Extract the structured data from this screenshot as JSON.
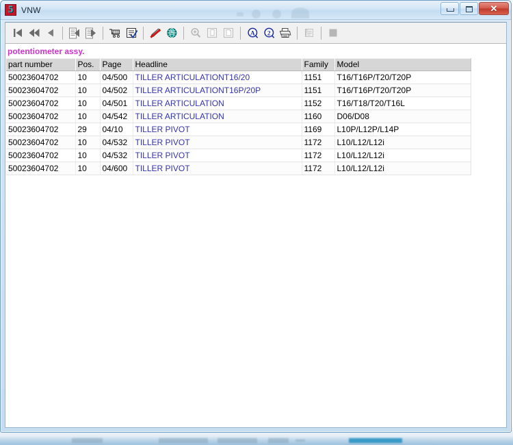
{
  "window": {
    "title": "VNW",
    "app_icon": "app-logo-icon",
    "icon_glyph": "5",
    "buttons": {
      "minimize": "minimize-button",
      "maximize": "maximize-button",
      "close": "close-button",
      "close_glyph": "✕"
    }
  },
  "toolbar": {
    "items": [
      {
        "name": "first-record-button",
        "icon": "skip-to-first-icon",
        "label": "First record",
        "enabled": true
      },
      {
        "name": "fast-rewind-button",
        "icon": "fast-rewind-icon",
        "label": "Rewind",
        "enabled": true
      },
      {
        "name": "previous-record-button",
        "icon": "previous-arrow-icon",
        "label": "Previous record",
        "enabled": true
      },
      {
        "name": "separator-1",
        "icon": "separator",
        "label": "",
        "enabled": false
      },
      {
        "name": "document-back-button",
        "icon": "document-left-arrow-icon",
        "label": "Previous document",
        "enabled": true
      },
      {
        "name": "document-forward-button",
        "icon": "document-right-arrow-icon",
        "label": "Next document",
        "enabled": true
      },
      {
        "name": "separator-2",
        "icon": "separator",
        "label": "",
        "enabled": false
      },
      {
        "name": "shopping-cart-button",
        "icon": "shopping-cart-icon",
        "label": "Basket",
        "enabled": true
      },
      {
        "name": "order-form-button",
        "icon": "checklist-form-icon",
        "label": "Order form",
        "enabled": true
      },
      {
        "name": "separator-3",
        "icon": "separator",
        "label": "",
        "enabled": false
      },
      {
        "name": "annotate-button",
        "icon": "pen-strikethrough-icon",
        "label": "Annotate",
        "enabled": true
      },
      {
        "name": "web-history-button",
        "icon": "globe-clock-icon",
        "label": "History",
        "enabled": true
      },
      {
        "name": "separator-4",
        "icon": "separator",
        "label": "",
        "enabled": false
      },
      {
        "name": "zoom-button",
        "icon": "magnifier-plus-icon",
        "label": "Zoom",
        "enabled": false
      },
      {
        "name": "page-copy-button",
        "icon": "page-icon",
        "label": "Page",
        "enabled": false
      },
      {
        "name": "page-new-button",
        "icon": "page-blank-icon",
        "label": "New page",
        "enabled": false
      },
      {
        "name": "separator-5",
        "icon": "separator",
        "label": "",
        "enabled": false
      },
      {
        "name": "text-search-button",
        "icon": "letter-a-circle-icon",
        "label": "Find text",
        "enabled": true
      },
      {
        "name": "second-search-button",
        "icon": "number-2-circle-icon",
        "label": "Search 2",
        "enabled": true
      },
      {
        "name": "print-button",
        "icon": "printer-icon",
        "label": "Print",
        "enabled": true
      },
      {
        "name": "separator-6",
        "icon": "separator",
        "label": "",
        "enabled": false
      },
      {
        "name": "notes-button",
        "icon": "notepad-icon",
        "label": "Notes",
        "enabled": false
      },
      {
        "name": "separator-7",
        "icon": "separator",
        "label": "",
        "enabled": false
      },
      {
        "name": "stop-button",
        "icon": "stop-square-icon",
        "label": "Stop",
        "enabled": false
      }
    ]
  },
  "colors": {
    "group_title": "#cc33cc",
    "link": "#3333aa",
    "header_bg": "#d6d6d6",
    "titlebar_accent": "#c4dcf1",
    "close_button": "#c4392b"
  },
  "content": {
    "group_title": "potentiometer assy.",
    "table": {
      "columns": [
        {
          "key": "part_number",
          "label": "part number"
        },
        {
          "key": "pos",
          "label": "Pos."
        },
        {
          "key": "page",
          "label": "Page"
        },
        {
          "key": "headline",
          "label": "Headline"
        },
        {
          "key": "family",
          "label": "Family"
        },
        {
          "key": "model",
          "label": "Model"
        }
      ],
      "rows": [
        {
          "part_number": "50023604702",
          "pos": "10",
          "page": "04/500",
          "headline_link": "TILLER ARTICULATION",
          "headline_suffix": "T16/20",
          "family": "1151",
          "model": "T16/T16P/T20/T20P"
        },
        {
          "part_number": "50023604702",
          "pos": "10",
          "page": "04/502",
          "headline_link": "TILLER ARTICULATION",
          "headline_suffix": "T16P/20P",
          "family": "1151",
          "model": "T16/T16P/T20/T20P"
        },
        {
          "part_number": "50023604702",
          "pos": "10",
          "page": "04/501",
          "headline_link": "TILLER ARTICULATION",
          "headline_suffix": "",
          "family": "1152",
          "model": "T16/T18/T20/T16L"
        },
        {
          "part_number": "50023604702",
          "pos": "10",
          "page": "04/542",
          "headline_link": "TILLER ARTICULATION",
          "headline_suffix": "",
          "family": "1160",
          "model": "D06/D08"
        },
        {
          "part_number": "50023604702",
          "pos": "29",
          "page": "04/10",
          "headline_link": "TILLER PIVOT",
          "headline_suffix": "",
          "family": "1169",
          "model": "L10P/L12P/L14P"
        },
        {
          "part_number": "50023604702",
          "pos": "10",
          "page": "04/532",
          "headline_link": "TILLER PIVOT",
          "headline_suffix": "",
          "family": "1172",
          "model": "L10/L12/L12i"
        },
        {
          "part_number": "50023604702",
          "pos": "10",
          "page": "04/532",
          "headline_link": "TILLER PIVOT",
          "headline_suffix": "",
          "family": "1172",
          "model": "L10/L12/L12i"
        },
        {
          "part_number": "50023604702",
          "pos": "10",
          "page": "04/600",
          "headline_link": "TILLER PIVOT",
          "headline_suffix": "",
          "family": "1172",
          "model": "L10/L12/L12i"
        }
      ]
    }
  }
}
